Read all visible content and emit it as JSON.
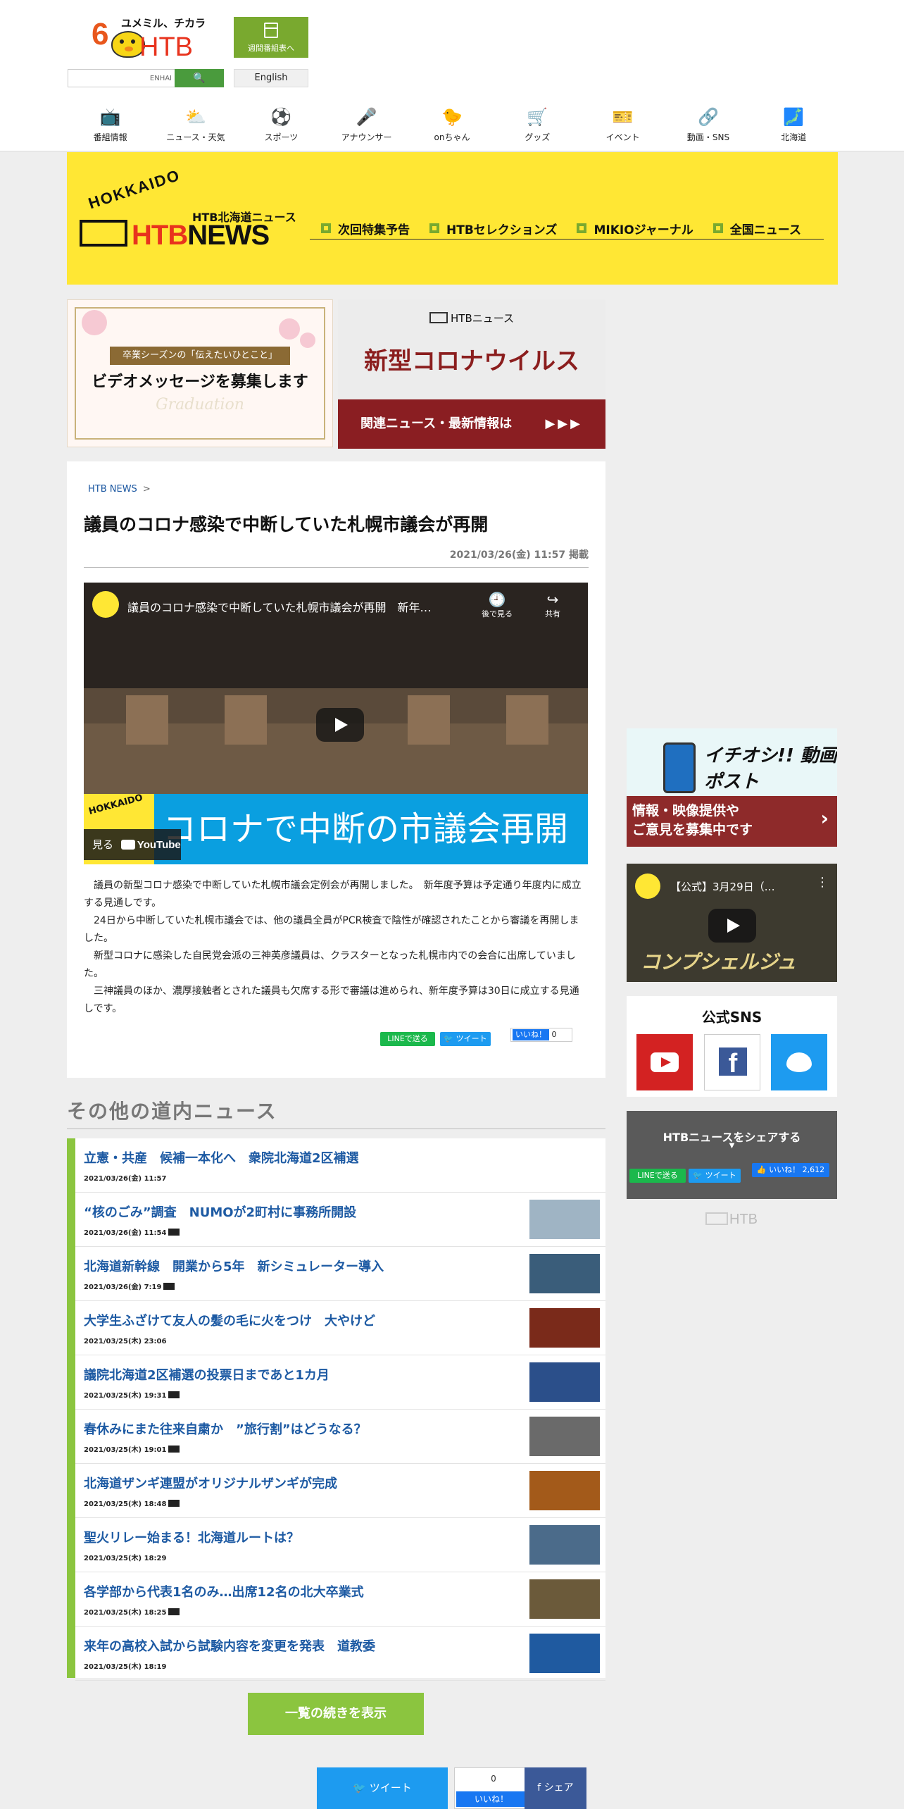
{
  "header": {
    "logo_number": "6",
    "logo_tagline": "ユメミル、チカラ",
    "logo_name": "HTB",
    "weekly_button": "週間番組表へ",
    "search_placeholder": "ENHAI",
    "search_icon": "search-icon",
    "english_button": "English"
  },
  "nav": [
    {
      "label": "番組情報",
      "icon": "tv-icon",
      "glyph": "📺",
      "color": "#d43b2b"
    },
    {
      "label": "ニュース・天気",
      "icon": "weather-icon",
      "glyph": "⛅",
      "color": "#ee7d2a"
    },
    {
      "label": "スポーツ",
      "icon": "ball-icon",
      "glyph": "⚽",
      "color": "#1f6fc0"
    },
    {
      "label": "アナウンサー",
      "icon": "microphone-icon",
      "glyph": "🎤",
      "color": "#8a2ad0"
    },
    {
      "label": "onちゃん",
      "icon": "onchan-icon",
      "glyph": "🐤",
      "color": "#f1c40f"
    },
    {
      "label": "グッズ",
      "icon": "cart-icon",
      "glyph": "🛒",
      "color": "#555555"
    },
    {
      "label": "イベント",
      "icon": "event-icon",
      "glyph": "🎫",
      "color": "#d43b2b"
    },
    {
      "label": "動画・SNS",
      "icon": "share-icon",
      "glyph": "🔗",
      "color": "#1a56a0"
    },
    {
      "label": "北海道",
      "icon": "hokkaido-map-icon",
      "glyph": "🗾",
      "color": "#2a9d6a"
    }
  ],
  "news_banner": {
    "hokkaido": "HOKKAIDO",
    "subtitle": "HTB北海道ニュース",
    "brand_red": "HTB",
    "brand_black": "NEWS",
    "menu": [
      "次回特集予告",
      "HTBセレクションズ",
      "MIKIOジャーナル",
      "全国ニュース"
    ]
  },
  "promos": {
    "left_tag": "卒業シーズンの「伝えたいひとこと」",
    "left_headline": "ビデオメッセージを募集します",
    "left_watermark": "Graduation",
    "right_logo": "HTBニュース",
    "right_title": "新型コロナウイルス",
    "right_bar": "関連ニュース・最新情報は",
    "right_arrows": "▶▶▶"
  },
  "article": {
    "breadcrumb": "HTB NEWS",
    "breadcrumb_sep": ">",
    "title": "議員のコロナ感染で中断していた札幌市議会が再開",
    "date": "2021/03/26(金) 11:57 掲載",
    "video": {
      "title": "議員のコロナ感染で中断していた札幌市議会が再開　新年…",
      "watch_later": "後で見る",
      "share": "共有",
      "caption": "コロナで中断の市議会再開",
      "watch_on": "見る",
      "youtube": "YouTube"
    },
    "paragraphs": [
      "議員の新型コロナ感染で中断していた札幌市議会定例会が再開しました。　新年度予算は予定通り年度内に成立する見通しです。",
      "24日から中断していた札幌市議会では、他の議員全員がPCR検査で陰性が確認されたことから審議を再開しました。",
      "新型コロナに感染した自民党会派の三神英彦議員は、クラスターとなった札幌市内での会合に出席していました。",
      "三神議員のほか、濃厚接触者とされた議員も欠席する形で審議は進められ、新年度予算は30日に成立する見通しです。"
    ],
    "share_line": "LINEで送る",
    "share_tweet": "ツイート",
    "share_like": "いいね！",
    "share_like_count": "0"
  },
  "other_news": {
    "title": "その他の道内ニュース",
    "items": [
      {
        "title": "立憲・共産　候補一本化へ　衆院北海道2区補選",
        "date": "2021/03/26(金) 11:57",
        "video": false,
        "thumb": ""
      },
      {
        "title": "“核のごみ”調査　NUMOが2町村に事務所開設",
        "date": "2021/03/26(金) 11:54",
        "video": true,
        "thumb": "#9fb4c4"
      },
      {
        "title": "北海道新幹線　開業から5年　新シミュレーター導入",
        "date": "2021/03/26(金) 7:19",
        "video": true,
        "thumb": "#3a5d7a"
      },
      {
        "title": "大学生ふざけて友人の髪の毛に火をつけ　大やけど",
        "date": "2021/03/25(木) 23:06",
        "video": false,
        "thumb": "#7a2a1a"
      },
      {
        "title": "議院北海道2区補選の投票日まであと1カ月",
        "date": "2021/03/25(木) 19:31",
        "video": true,
        "thumb": "#2b4f8a"
      },
      {
        "title": "春休みにまた往来自粛か　”旅行割”はどうなる？",
        "date": "2021/03/25(木) 19:01",
        "video": true,
        "thumb": "#6a6a6a"
      },
      {
        "title": "北海道ザンギ連盟がオリジナルザンギが完成",
        "date": "2021/03/25(木) 18:48",
        "video": true,
        "thumb": "#a35a1a"
      },
      {
        "title": "聖火リレー始まる！北海道ルートは？",
        "date": "2021/03/25(木) 18:29",
        "video": false,
        "thumb": "#4b6b8a"
      },
      {
        "title": "各学部から代表1名のみ…出席12名の北大卒業式",
        "date": "2021/03/25(木) 18:25",
        "video": true,
        "thumb": "#6b5a3a"
      },
      {
        "title": "来年の高校入試から試験内容を変更を発表　道教委",
        "date": "2021/03/25(木) 18:19",
        "video": false,
        "thumb": "#1f5aa0"
      }
    ],
    "more_button": "一覧の続きを表示"
  },
  "bottom_share": {
    "tweet": "ツイート",
    "like_count": "0",
    "like": "いいね！",
    "share": "シェア"
  },
  "sidebar": {
    "video_post_title": "イチオシ!! 動画ポスト",
    "video_post_line1": "情報・映像提供や",
    "video_post_line2": "ご意見を募集中です",
    "yt_title": "【公式】3月29日（…",
    "yt_overlay": "コンプシェルジュ",
    "sns_title": "公式SNS",
    "share_title": "HTBニュースをシェアする",
    "share_arrow": "▼",
    "share_line": "LINEで送る",
    "share_tweet": "ツイート",
    "share_like": "いいね！ 2,612",
    "footer_logo": "HTB"
  },
  "colors": {
    "accent_green": "#8bc53f",
    "banner_yellow": "#ffe734",
    "link_blue": "#1d5aa3"
  }
}
